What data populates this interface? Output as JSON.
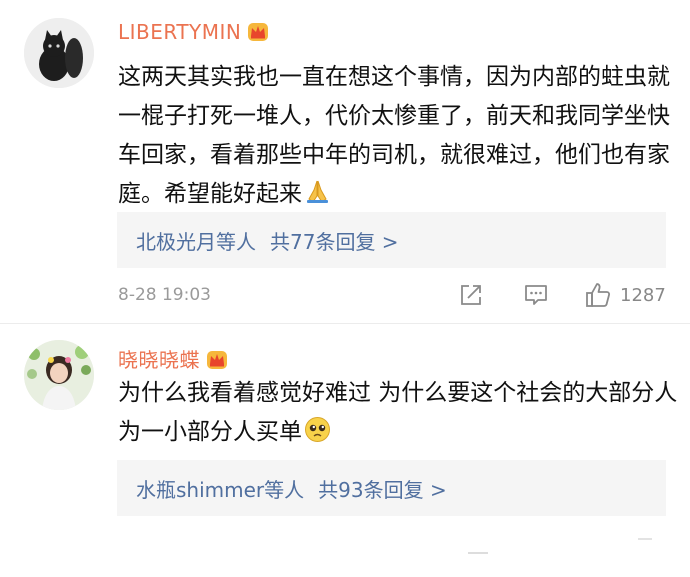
{
  "comments": [
    {
      "username": "LIBERTYMIN",
      "avatar_icon": "black-cat-avatar",
      "badge_icon": "vip-crown-icon",
      "text": "这两天其实我也一直在想这个事情，因为内部的蛀虫就一棍子打死一堆人，代价太惨重了，前天和我同学坐快车回家，看着那些中年的司机，就很难过，他们也有家庭。希望能好起来",
      "emoji": "folded-hands-emoji",
      "replies": {
        "names": "北极光月等人",
        "count_label": "共77条回复 >"
      },
      "timestamp": "8-28 19:03",
      "likes": "1287"
    },
    {
      "username": "晓晓晓蝶",
      "avatar_icon": "girl-with-flowers-avatar",
      "badge_icon": "vip-crown-icon",
      "text": "为什么我看着感觉好难过 为什么要这个社会的大部分人为一小部分人买单",
      "emoji": "pleading-face-emoji",
      "replies": {
        "names": "水瓶shimmer等人",
        "count_label": "共93条回复 >"
      }
    }
  ],
  "colors": {
    "username": "#eb7350",
    "link": "#506f9f",
    "reply_bg": "#f5f5f5",
    "meta": "#9a9a9a"
  }
}
